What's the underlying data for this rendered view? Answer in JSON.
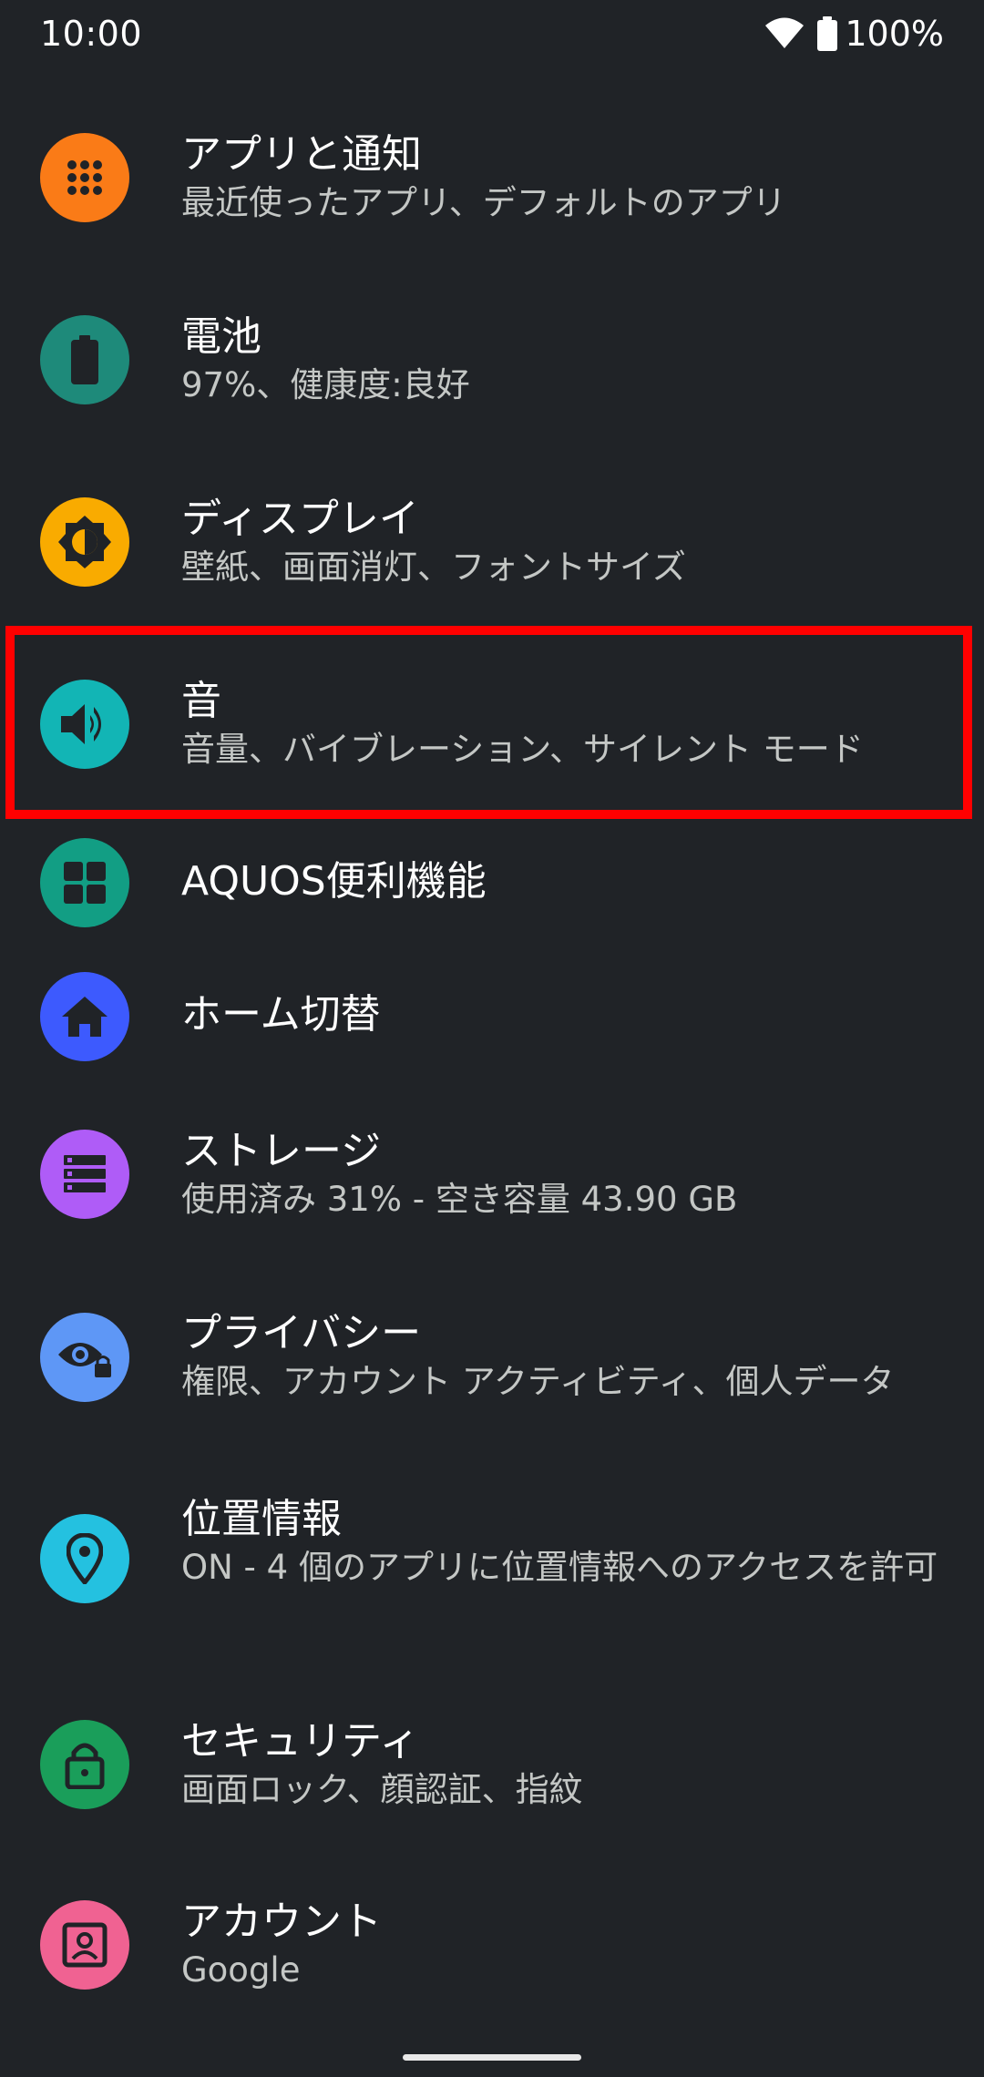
{
  "status_bar": {
    "time": "10:00",
    "battery": "100%"
  },
  "settings": {
    "items": [
      {
        "title": "アプリと通知",
        "subtitle": "最近使ったアプリ、デフォルトのアプリ",
        "icon": "apps-grid-icon",
        "color": "#fa7b17"
      },
      {
        "title": "電池",
        "subtitle": "97%、健康度:良好",
        "icon": "battery-icon",
        "color": "#1e8a7a"
      },
      {
        "title": "ディスプレイ",
        "subtitle": "壁紙、画面消灯、フォントサイズ",
        "icon": "brightness-icon",
        "color": "#f9ab00"
      },
      {
        "title": "音",
        "subtitle": "音量、バイブレーション、サイレント モード",
        "icon": "volume-icon",
        "color": "#12b5b5"
      },
      {
        "title": "AQUOS便利機能",
        "subtitle": "",
        "icon": "aquos-grid-icon",
        "color": "#129e84"
      },
      {
        "title": "ホーム切替",
        "subtitle": "",
        "icon": "home-icon",
        "color": "#3d5afe"
      },
      {
        "title": "ストレージ",
        "subtitle": "使用済み 31% - 空き容量 43.90 GB",
        "icon": "storage-icon",
        "color": "#af5cf7"
      },
      {
        "title": "プライバシー",
        "subtitle": "権限、アカウント アクティビティ、個人データ",
        "icon": "privacy-eye-icon",
        "color": "#5e97f6"
      },
      {
        "title": "位置情報",
        "subtitle": "ON - 4 個のアプリに位置情報へのアクセスを許可",
        "icon": "location-pin-icon",
        "color": "#24c1e0"
      },
      {
        "title": "セキュリティ",
        "subtitle": "画面ロック、顔認証、指紋",
        "icon": "lock-icon",
        "color": "#1a9e5a"
      },
      {
        "title": "アカウント",
        "subtitle": "Google",
        "icon": "account-box-icon",
        "color": "#f06292"
      }
    ]
  }
}
